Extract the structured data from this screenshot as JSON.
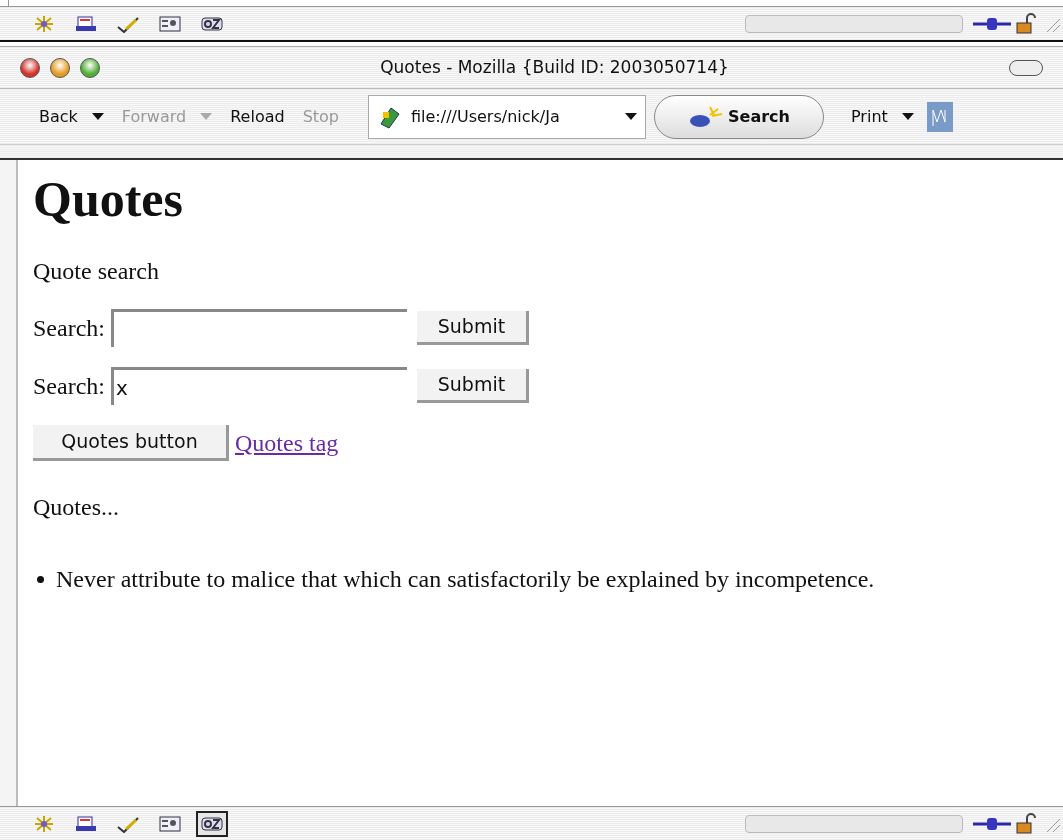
{
  "upper_status_bar": {
    "components": [
      {
        "kind": "navigator",
        "selected": false
      },
      {
        "kind": "mail",
        "selected": false
      },
      {
        "kind": "composer",
        "selected": false
      },
      {
        "kind": "addressbook",
        "selected": false
      },
      {
        "kind": "chatzilla",
        "selected": false
      }
    ]
  },
  "window": {
    "title": "Quotes - Mozilla {Build ID: 2003050714}"
  },
  "toolbar": {
    "buttons": [
      {
        "label": "Back",
        "disabled": false,
        "dropdown": true
      },
      {
        "label": "Forward",
        "disabled": true,
        "dropdown": true
      },
      {
        "label": "Reload",
        "disabled": false,
        "dropdown": false
      },
      {
        "label": "Stop",
        "disabled": true,
        "dropdown": false
      }
    ],
    "url": "file:///Users/nick/Ja",
    "search": "Search",
    "print": "Print"
  },
  "page": {
    "heading": "Quotes",
    "subtitle": "Quote search",
    "forms": [
      {
        "label": "Search:",
        "button": "Submit"
      },
      {
        "label": "Search:",
        "value": "x",
        "button": "Submit"
      }
    ],
    "quotes_button": "Quotes button",
    "quotes_link": "Quotes tag",
    "list_title": "Quotes...",
    "quotes": [
      "Never attribute to malice that which can satisfactorily be explained by incompetence."
    ]
  },
  "status_bar": {
    "components": [
      {
        "kind": "navigator",
        "selected": false
      },
      {
        "kind": "mail",
        "selected": false
      },
      {
        "kind": "composer",
        "selected": false
      },
      {
        "kind": "addressbook",
        "selected": false
      },
      {
        "kind": "chatzilla",
        "selected": true
      }
    ]
  }
}
